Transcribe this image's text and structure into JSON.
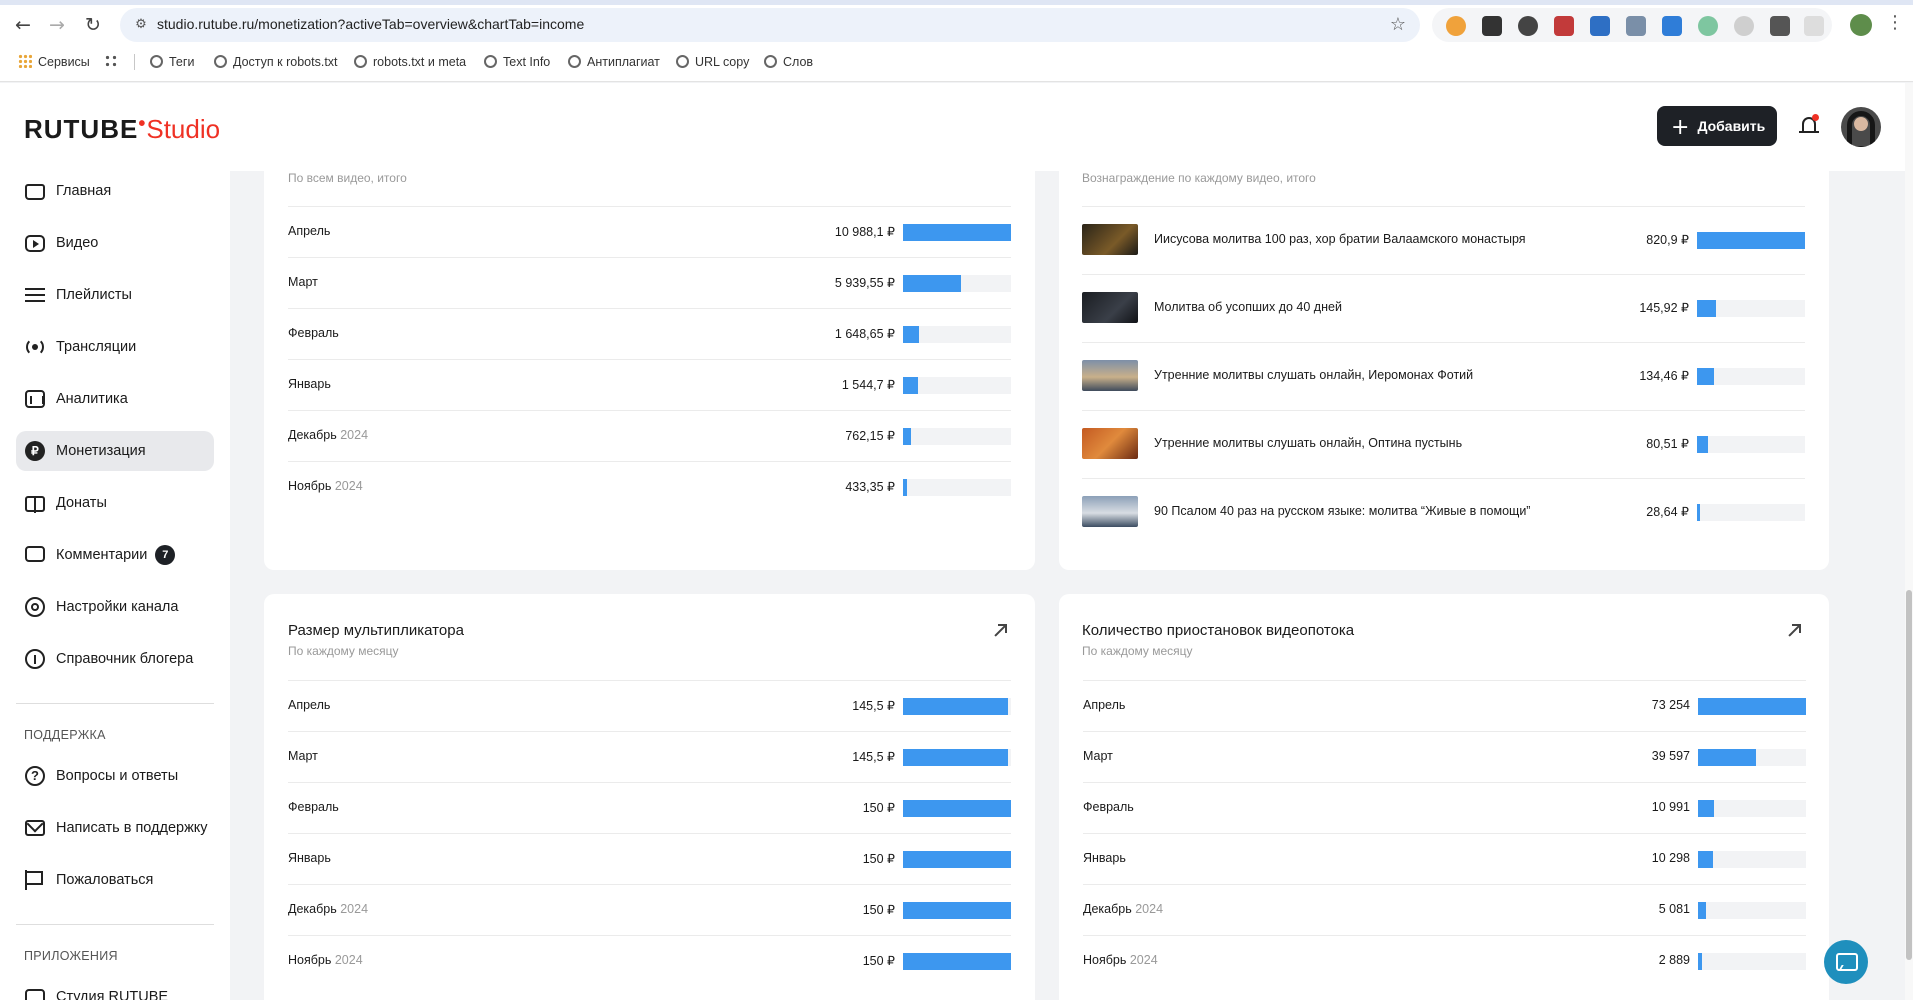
{
  "browser": {
    "url": "studio.rutube.ru/monetization?activeTab=overview&chartTab=income",
    "bookmarks": [
      "Сервисы",
      "Теги",
      "Доступ к robots.txt",
      "robots.txt и meta",
      "Text Info",
      "Антиплагиат",
      "URL copy",
      "Слов"
    ]
  },
  "header": {
    "logo_main": "RUTUBE",
    "logo_studio": "Studio",
    "add_button": "Добавить"
  },
  "sidebar": {
    "items": [
      {
        "label": "Главная",
        "icon": "home-icon"
      },
      {
        "label": "Видео",
        "icon": "video-icon"
      },
      {
        "label": "Плейлисты",
        "icon": "playlist-icon"
      },
      {
        "label": "Трансляции",
        "icon": "broadcast-icon"
      },
      {
        "label": "Аналитика",
        "icon": "analytics-icon"
      },
      {
        "label": "Монетизация",
        "icon": "ruble-icon",
        "active": true
      },
      {
        "label": "Донаты",
        "icon": "gift-icon"
      },
      {
        "label": "Комментарии",
        "icon": "comment-icon",
        "badge": "7"
      },
      {
        "label": "Настройки канала",
        "icon": "gear-icon"
      },
      {
        "label": "Справочник блогера",
        "icon": "info-icon"
      }
    ],
    "support_heading": "ПОДДЕРЖКА",
    "support_items": [
      {
        "label": "Вопросы и ответы",
        "icon": "help-icon"
      },
      {
        "label": "Написать в поддержку",
        "icon": "mail-icon"
      },
      {
        "label": "Пожаловаться",
        "icon": "flag-icon"
      }
    ],
    "apps_heading": "ПРИЛОЖЕНИЯ",
    "apps_items": [
      {
        "label": "Студия RUTUBE",
        "icon": "studio-app-icon"
      }
    ]
  },
  "colors": {
    "accent": "#ef3124",
    "bar": "#3d97ef",
    "bar_track": "#f2f3f5"
  },
  "cards": {
    "income": {
      "subtitle": "По всем видео, итого",
      "rows": [
        {
          "month": "Апрель",
          "year": "",
          "value": "10 988,1 ₽",
          "fill": 1.0
        },
        {
          "month": "Март",
          "year": "",
          "value": "5 939,55 ₽",
          "fill": 0.54
        },
        {
          "month": "Февраль",
          "year": "",
          "value": "1 648,65 ₽",
          "fill": 0.15
        },
        {
          "month": "Январь",
          "year": "",
          "value": "1 544,7 ₽",
          "fill": 0.14
        },
        {
          "month": "Декабрь",
          "year": "2024",
          "value": "762,15 ₽",
          "fill": 0.07
        },
        {
          "month": "Ноябрь",
          "year": "2024",
          "value": "433,35 ₽",
          "fill": 0.04
        }
      ]
    },
    "per_video": {
      "subtitle": "Вознаграждение по каждому видео, итого",
      "rows": [
        {
          "title": "Иисусова молитва 100 раз, хор братии Валаамского монастыря",
          "value": "820,9 ₽",
          "fill": 1.0
        },
        {
          "title": "Молитва об усопших до 40 дней",
          "value": "145,92 ₽",
          "fill": 0.18
        },
        {
          "title": "Утренние молитвы слушать онлайн, Иеромонах Фотий",
          "value": "134,46 ₽",
          "fill": 0.16
        },
        {
          "title": "Утренние молитвы слушать онлайн, Оптина пустынь",
          "value": "80,51 ₽",
          "fill": 0.1
        },
        {
          "title": "90 Псалом 40 раз на русском языке: молитва “Живые в помощи”",
          "value": "28,64 ₽",
          "fill": 0.03
        }
      ]
    },
    "multiplier": {
      "title": "Размер мультипликатора",
      "subtitle": "По каждому месяцу",
      "rows": [
        {
          "month": "Апрель",
          "year": "",
          "value": "145,5 ₽",
          "fill": 0.97
        },
        {
          "month": "Март",
          "year": "",
          "value": "145,5 ₽",
          "fill": 0.97
        },
        {
          "month": "Февраль",
          "year": "",
          "value": "150 ₽",
          "fill": 1.0
        },
        {
          "month": "Январь",
          "year": "",
          "value": "150 ₽",
          "fill": 1.0
        },
        {
          "month": "Декабрь",
          "year": "2024",
          "value": "150 ₽",
          "fill": 1.0
        },
        {
          "month": "Ноябрь",
          "year": "2024",
          "value": "150 ₽",
          "fill": 1.0
        }
      ]
    },
    "stalls": {
      "title": "Количество приостановок видеопотока",
      "subtitle": "По каждому месяцу",
      "rows": [
        {
          "month": "Апрель",
          "year": "",
          "value": "73 254",
          "fill": 1.0
        },
        {
          "month": "Март",
          "year": "",
          "value": "39 597",
          "fill": 0.54
        },
        {
          "month": "Февраль",
          "year": "",
          "value": "10 991",
          "fill": 0.15
        },
        {
          "month": "Январь",
          "year": "",
          "value": "10 298",
          "fill": 0.14
        },
        {
          "month": "Декабрь",
          "year": "2024",
          "value": "5 081",
          "fill": 0.07
        },
        {
          "month": "Ноябрь",
          "year": "2024",
          "value": "2 889",
          "fill": 0.04
        }
      ]
    }
  }
}
